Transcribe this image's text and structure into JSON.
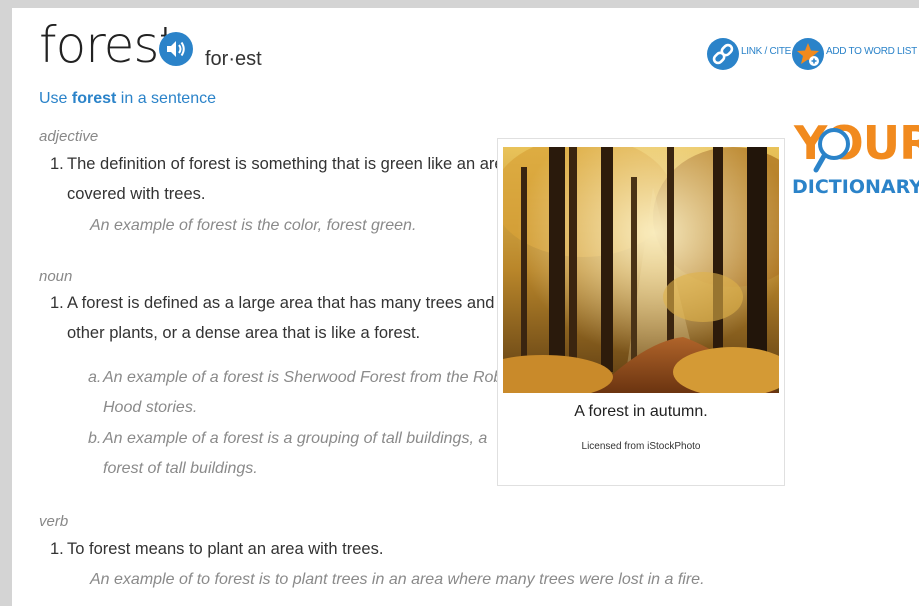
{
  "entry": {
    "word": "forest",
    "syllables": "for·est",
    "use_prefix": "Use ",
    "use_word": "forest",
    "use_suffix": " in a sentence"
  },
  "tools": {
    "link_cite": "LINK / CITE",
    "add_to_word_list": "ADD TO WORD LIST"
  },
  "logo": {
    "top": "YOUR",
    "bottom": "DICTIONARY"
  },
  "image": {
    "caption": "A forest in autumn.",
    "license": "Licensed from iStockPhoto"
  },
  "sections": {
    "adjective": {
      "pos": "adjective",
      "num": "1.",
      "def_line1": "The definition of forest is something that is green like an area",
      "def_line2": "covered with trees.",
      "example": "An example of forest is the color, forest green."
    },
    "noun": {
      "pos": "noun",
      "num": "1.",
      "def_line1": "A forest is defined as a large area that has many trees and",
      "def_line2": "other plants, or a dense area that is like a forest.",
      "ex_a_letter": "a.",
      "ex_a_line1": "An example of a forest is Sherwood Forest from the Robin",
      "ex_a_line2": "Hood stories.",
      "ex_b_letter": "b.",
      "ex_b_line1": "An example of a forest is a grouping of tall buildings, a",
      "ex_b_line2": "forest of tall buildings."
    },
    "verb": {
      "pos": "verb",
      "num": "1.",
      "def_line1": "To forest means to plant an area with trees.",
      "example": "An example of to forest is to plant trees in an area where many trees were lost in a fire."
    }
  },
  "colors": {
    "accent": "#2b83c9",
    "logo_orange": "#f18a1e",
    "muted": "#8a8a8a"
  }
}
